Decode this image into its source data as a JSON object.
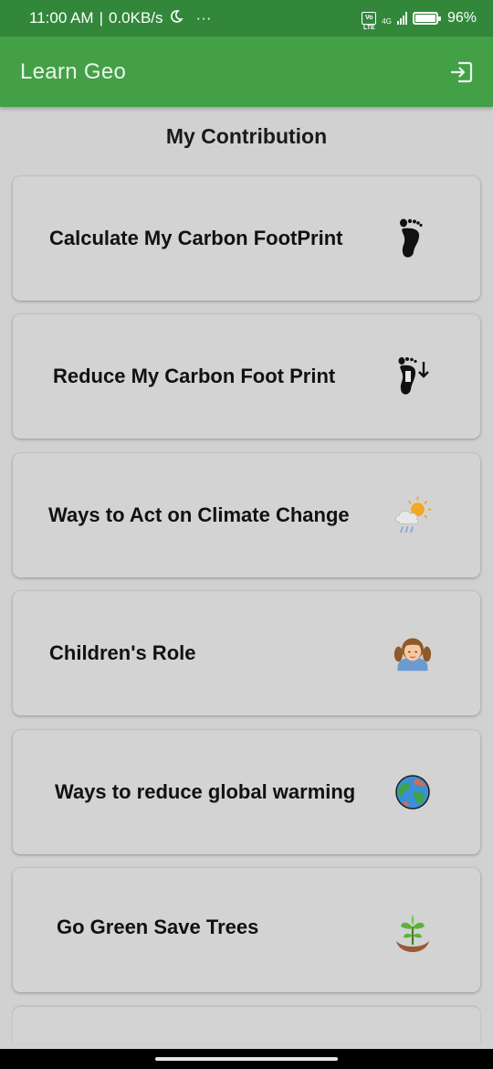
{
  "status_bar": {
    "time": "11:00 AM",
    "network_speed": "0.0KB/s",
    "more": "···",
    "volte": "Vo LTE",
    "network_type": "4G",
    "battery_percent": "96%"
  },
  "app_bar": {
    "title": "Learn Geo",
    "exit_icon": "exit-icon"
  },
  "page": {
    "heading": "My Contribution"
  },
  "cards": [
    {
      "label": "Calculate My Carbon FootPrint",
      "icon": "footprint-icon"
    },
    {
      "label": "Reduce My Carbon Foot Print",
      "icon": "footprint-reduce-icon"
    },
    {
      "label": "Ways to Act on Climate Change",
      "icon": "weather-sun-rain-icon"
    },
    {
      "label": "Children's Role",
      "icon": "girl-icon"
    },
    {
      "label": "Ways to reduce global warming",
      "icon": "earth-icon"
    },
    {
      "label": "Go Green Save Trees",
      "icon": "plant-in-hands-icon"
    }
  ],
  "colors": {
    "status_bar": "#32873a",
    "app_bar": "#43a047",
    "background": "#d1d1d1",
    "card": "#d3d3d3"
  }
}
